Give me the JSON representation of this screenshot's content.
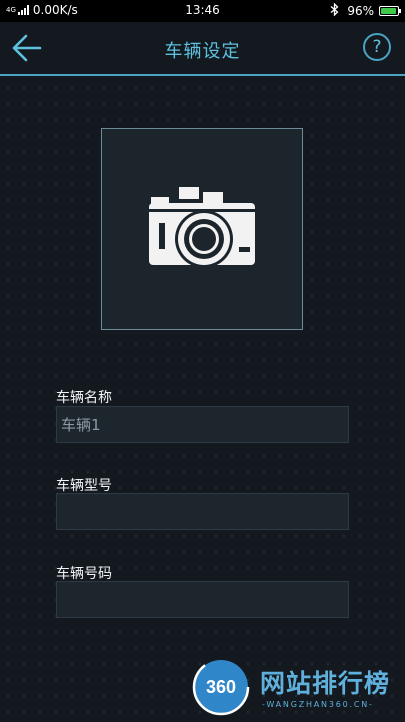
{
  "status_bar": {
    "network_type": "4G",
    "network_speed": "0.00K/s",
    "time": "13:46",
    "battery_percent": "96%",
    "battery_level": 0.96
  },
  "header": {
    "title": "车辆设定",
    "help_symbol": "?",
    "icons": {
      "back": "back-arrow-icon",
      "help": "question-circle-icon"
    }
  },
  "photo": {
    "icon": "camera-icon"
  },
  "form": {
    "name_label": "车辆名称",
    "name_value": "车辆1",
    "model_label": "车辆型号",
    "model_value": "",
    "plate_label": "车辆号码",
    "plate_value": ""
  },
  "watermark": {
    "logo_text": "360",
    "text": "网站排行榜",
    "sub_text": "-WANGZHAN360.CN-"
  },
  "colors": {
    "accent": "#5ec1e0",
    "background": "#13191e",
    "input_bg": "#1d262d",
    "battery_green": "#3fc84a"
  }
}
